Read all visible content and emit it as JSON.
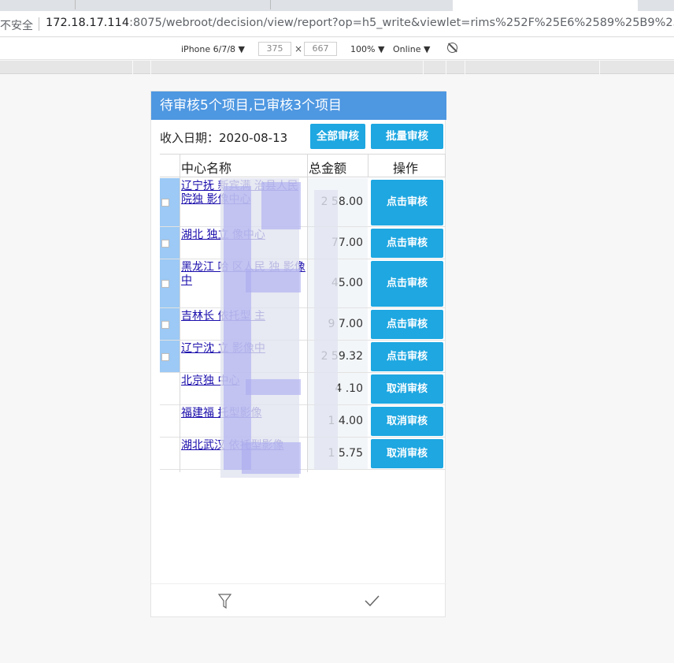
{
  "browser": {
    "security_label": "不安全",
    "url_host": "172.18.17.114",
    "url_rest": ":8075/webroot/decision/view/report?op=h5_write&viewlet=rims%252F%25E6%2589%25B9%25E9%2587"
  },
  "devtools": {
    "device": "iPhone 6/7/8 ▼",
    "width": "375",
    "height": "667",
    "times": "×",
    "zoom": "100% ▼",
    "network": "Online ▼"
  },
  "report": {
    "banner": "待审核5个项目,已审核3个项目",
    "date_label": "收入日期：2020-08-13",
    "approve_all_label": "全部审核",
    "batch_label": "批量审核",
    "columns": [
      "中心名称",
      "总金额",
      "操作"
    ],
    "rows": [
      {
        "name": "辽宁抚  新宾满  治县人民  院独  影像中心",
        "amount": "2   58.00",
        "action": "点击审核",
        "selected": true
      },
      {
        "name": "湖北  独立  像中心",
        "amount": "  77.00",
        "action": "点击审核",
        "selected": true
      },
      {
        "name": "黑龙江  哈  区人民  独  影像中",
        "amount": "  45.00",
        "action": "点击审核",
        "selected": true
      },
      {
        "name": "吉林长  依托型  主",
        "amount": "9   7.00",
        "action": "点击审核",
        "selected": true
      },
      {
        "name": "辽宁沈  立  影像中",
        "amount": "2  59.32",
        "action": "点击审核",
        "selected": true
      },
      {
        "name": "北京独  中心",
        "amount": "4  .10",
        "action": "取消审核",
        "selected": false
      },
      {
        "name": "福建福  托型影像",
        "amount": "1  4.00",
        "action": "取消审核",
        "selected": false
      },
      {
        "name": "湖北武汉  依托型影像",
        "amount": "1  5.75",
        "action": "取消审核",
        "selected": false
      }
    ]
  },
  "footer": {
    "filter_icon": "filter-icon",
    "confirm_icon": "check-icon"
  }
}
